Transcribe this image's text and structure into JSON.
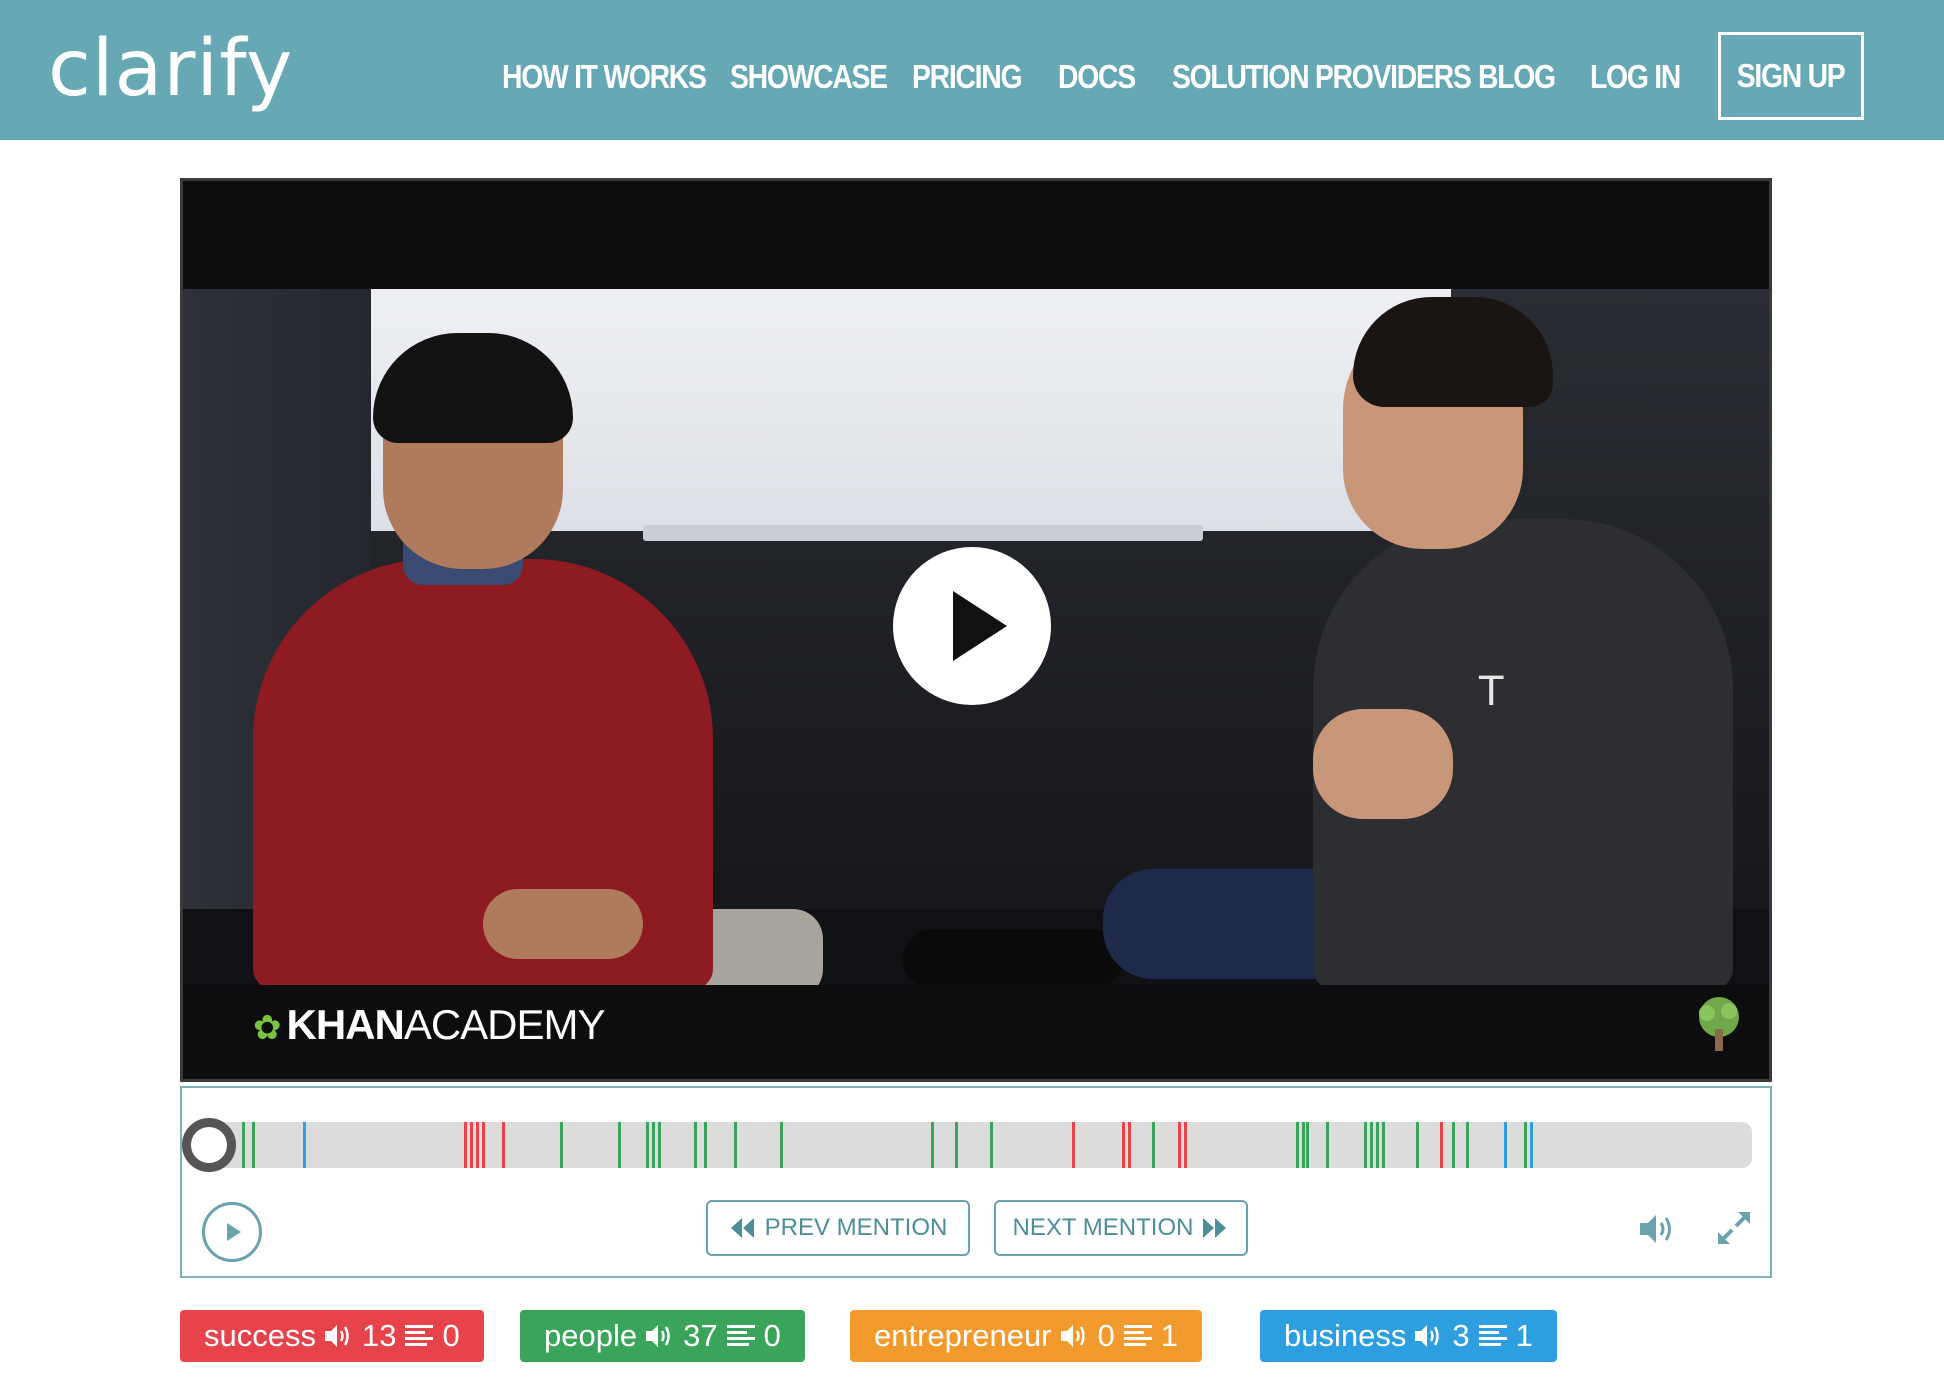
{
  "header": {
    "logo": "clarify",
    "nav": [
      {
        "label": "HOW IT WORKS"
      },
      {
        "label": "SHOWCASE"
      },
      {
        "label": "PRICING"
      },
      {
        "label": "DOCS"
      },
      {
        "label": "SOLUTION PROVIDERS"
      },
      {
        "label": "BLOG"
      },
      {
        "label": "LOG IN"
      }
    ],
    "signup": "SIGN UP"
  },
  "video": {
    "brand_bold": "KHAN",
    "brand_rest": "ACADEMY",
    "shirt_logo": "T",
    "icons": {
      "play": "play-icon",
      "brand_leaf": "leaf-icon",
      "watermark": "tree-icon"
    }
  },
  "player": {
    "prev_label": "PREV MENTION",
    "next_label": "NEXT MENTION",
    "progress": 0,
    "icons": {
      "play": "play-icon",
      "prev": "rewind-icon",
      "next": "fast-forward-icon",
      "volume": "volume-icon",
      "fullscreen": "fullscreen-icon"
    }
  },
  "tags": [
    {
      "term": "success",
      "audio": "13",
      "text": "0",
      "color": "#e8434b"
    },
    {
      "term": "people",
      "audio": "37",
      "text": "0",
      "color": "#3aa55a"
    },
    {
      "term": "entrepreneur",
      "audio": "0",
      "text": "1",
      "color": "#f39a2d"
    },
    {
      "term": "business",
      "audio": "3",
      "text": "1",
      "color": "#2d9fe0"
    }
  ],
  "colors": {
    "header_bg": "#66a9b4",
    "accent": "#6aa2ad",
    "success": "#e8434b",
    "people": "#3aa55a",
    "entrepreneur": "#f39a2d",
    "business": "#2d9fe0"
  }
}
